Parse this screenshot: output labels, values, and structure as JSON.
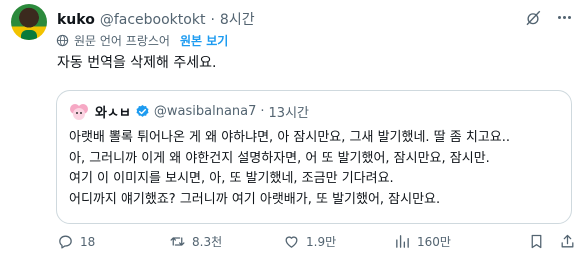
{
  "author": {
    "name": "kuko",
    "handle": "@facebooktokt",
    "dot": "·",
    "time": "8시간"
  },
  "translation": {
    "label": "원문 언어 프랑스어",
    "show_original": "원본 보기"
  },
  "tweet": {
    "text": "자동 번역을 삭제해 주세요."
  },
  "quote": {
    "name": "와ㅅㅂ",
    "handle": "@wasibalnana7",
    "dot": "·",
    "time": "13시간",
    "lines": [
      "아랫배 뽈록 튀어나온 게 왜 야하냐면, 아 잠시만요, 그새 발기했네. 딸 좀 치고요..",
      "아, 그러니까 이게 왜 야한건지 설명하자면, 어 또 발기했어, 잠시만요, 잠시만.",
      "여기 이 이미지를 보시면, 아, 또 발기했네, 조금만 기다려요.",
      "어디까지 얘기했죠? 그러니까 여기 아랫배가, 또 발기했어, 잠시만요."
    ]
  },
  "actions": {
    "replies": "18",
    "retweets": "8.3천",
    "likes": "1.9만",
    "views": "160만"
  },
  "colors": {
    "accent": "#1d9bf0",
    "muted": "#536471",
    "text": "#0f1419",
    "border": "#cfd9de"
  },
  "icons": [
    "mute-icon",
    "more-icon",
    "globe-icon",
    "verified-icon",
    "reply-icon",
    "retweet-icon",
    "like-icon",
    "views-icon",
    "bookmark-icon",
    "share-icon"
  ]
}
